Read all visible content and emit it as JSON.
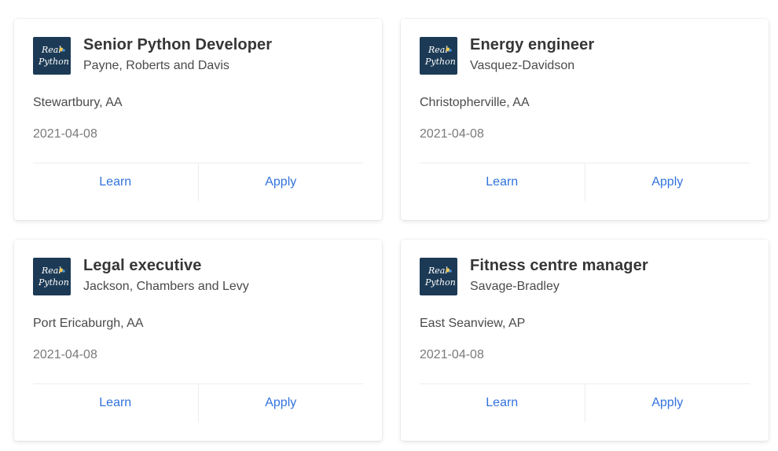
{
  "brand": {
    "logo_text_line1": "Real",
    "logo_text_line2": "Python",
    "logo_bg": "#1c3a55",
    "link_color": "#3273dc"
  },
  "jobs": [
    {
      "title": "Senior Python Developer",
      "company": "Payne, Roberts and Davis",
      "location": "Stewartbury, AA",
      "date": "2021-04-08",
      "learn_label": "Learn",
      "apply_label": "Apply"
    },
    {
      "title": "Energy engineer",
      "company": "Vasquez-Davidson",
      "location": "Christopherville, AA",
      "date": "2021-04-08",
      "learn_label": "Learn",
      "apply_label": "Apply"
    },
    {
      "title": "Legal executive",
      "company": "Jackson, Chambers and Levy",
      "location": "Port Ericaburgh, AA",
      "date": "2021-04-08",
      "learn_label": "Learn",
      "apply_label": "Apply"
    },
    {
      "title": "Fitness centre manager",
      "company": "Savage-Bradley",
      "location": "East Seanview, AP",
      "date": "2021-04-08",
      "learn_label": "Learn",
      "apply_label": "Apply"
    }
  ]
}
